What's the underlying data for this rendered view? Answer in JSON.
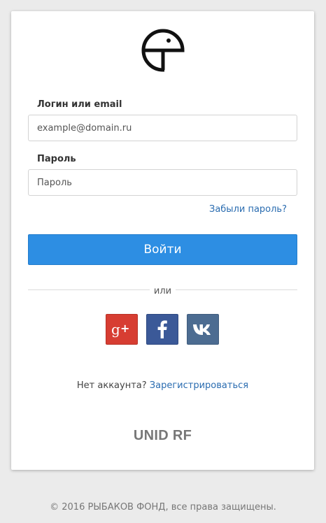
{
  "form": {
    "login_label": "Логин или email",
    "login_placeholder": "example@domain.ru",
    "password_label": "Пароль",
    "password_placeholder": "Пароль",
    "forgot_link": "Забыли пароль?",
    "submit_label": "Войти"
  },
  "divider": {
    "text": "или"
  },
  "social": [
    {
      "name": "Google+",
      "icon": "google-plus-icon",
      "color": "#d73d32"
    },
    {
      "name": "Facebook",
      "icon": "facebook-icon",
      "color": "#3b5998"
    },
    {
      "name": "VK",
      "icon": "vk-icon",
      "color": "#4c6c91"
    }
  ],
  "register": {
    "prompt": "Нет аккаунта?",
    "link": "Зарегистрироваться"
  },
  "brand": {
    "name": "UNID RF"
  },
  "footer": {
    "text": "© 2016 РЫБАКОВ ФОНД, все права защищены."
  },
  "colors": {
    "primary": "#2d8ee3",
    "link": "#2a6cb0",
    "background": "#ebebeb"
  }
}
